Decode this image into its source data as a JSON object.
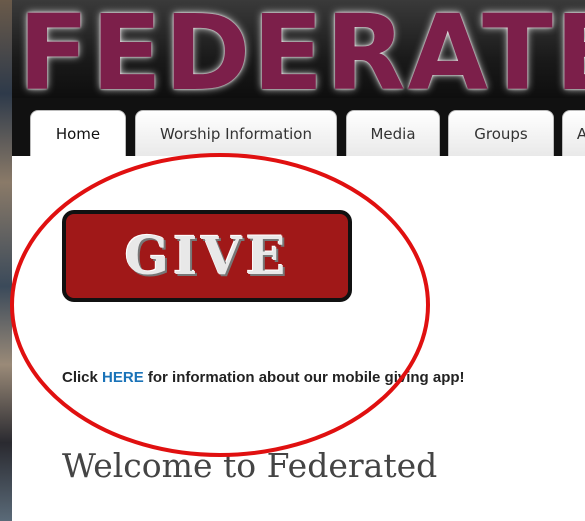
{
  "site": {
    "banner_title": "FEDERATED"
  },
  "nav": {
    "tabs": [
      {
        "label": "Home",
        "active": true
      },
      {
        "label": "Worship Information",
        "active": false
      },
      {
        "label": "Media",
        "active": false
      },
      {
        "label": "Groups",
        "active": false
      },
      {
        "label": "A",
        "active": false
      }
    ]
  },
  "main": {
    "give_button_label": "GIVE",
    "info_prefix": "Click ",
    "info_link": "HERE",
    "info_suffix": " for information about our mobile giving app!",
    "welcome_heading": "Welcome to Federated"
  },
  "annotation": {
    "color": "#e01010"
  }
}
